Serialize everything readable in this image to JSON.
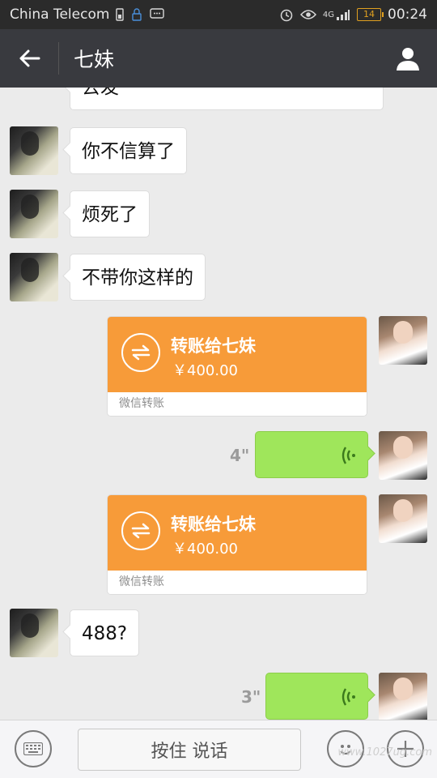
{
  "status_bar": {
    "carrier": "China Telecom",
    "network": "4G",
    "battery": "14",
    "time": "00:24"
  },
  "header": {
    "title": "七妹"
  },
  "messages": [
    {
      "type": "text",
      "side": "left",
      "text": "去发"
    },
    {
      "type": "text",
      "side": "left",
      "text": "你不信算了"
    },
    {
      "type": "text",
      "side": "left",
      "text": "烦死了"
    },
    {
      "type": "text",
      "side": "left",
      "text": "不带你这样的"
    },
    {
      "type": "transfer",
      "side": "right",
      "title": "转账给七妹",
      "amount": "￥400.00",
      "footer": "微信转账"
    },
    {
      "type": "voice",
      "side": "right",
      "duration": "4\""
    },
    {
      "type": "transfer",
      "side": "right",
      "title": "转账给七妹",
      "amount": "￥400.00",
      "footer": "微信转账"
    },
    {
      "type": "text",
      "side": "left",
      "text": "488?"
    },
    {
      "type": "voice",
      "side": "right",
      "duration": "3\""
    }
  ],
  "input_bar": {
    "hold_to_talk": "按住 说话"
  },
  "watermark": "www.1027ug.com",
  "colors": {
    "header_bg": "#393a3f",
    "transfer_orange": "#f79b39",
    "voice_green": "#9fe65b",
    "chat_bg": "#ebebeb"
  }
}
